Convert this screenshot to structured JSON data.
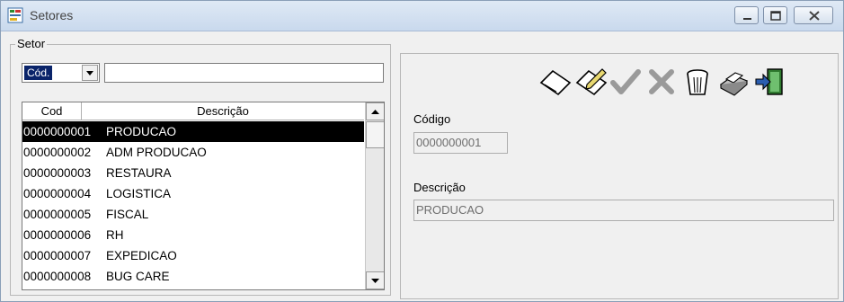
{
  "window": {
    "title": "Setores"
  },
  "setor_group": {
    "legend": "Setor",
    "combo_selected": "Cód.",
    "search_value": ""
  },
  "list": {
    "headers": [
      "Cod",
      "Descrição"
    ],
    "rows": [
      {
        "code": "0000000001",
        "desc": "PRODUCAO"
      },
      {
        "code": "0000000002",
        "desc": "ADM PRODUCAO"
      },
      {
        "code": "0000000003",
        "desc": "RESTAURA"
      },
      {
        "code": "0000000004",
        "desc": "LOGISTICA"
      },
      {
        "code": "0000000005",
        "desc": "FISCAL"
      },
      {
        "code": "0000000006",
        "desc": "RH"
      },
      {
        "code": "0000000007",
        "desc": "EXPEDICAO"
      },
      {
        "code": "0000000008",
        "desc": "BUG CARE"
      }
    ],
    "selected_index": 0
  },
  "toolbar": {
    "icons": [
      "new-icon",
      "edit-icon",
      "confirm-icon",
      "cancel-icon",
      "delete-icon",
      "print-icon",
      "exit-icon"
    ]
  },
  "form": {
    "codigo_label": "Código",
    "codigo_value": "0000000001",
    "descricao_label": "Descrição",
    "descricao_value": "PRODUCAO"
  }
}
